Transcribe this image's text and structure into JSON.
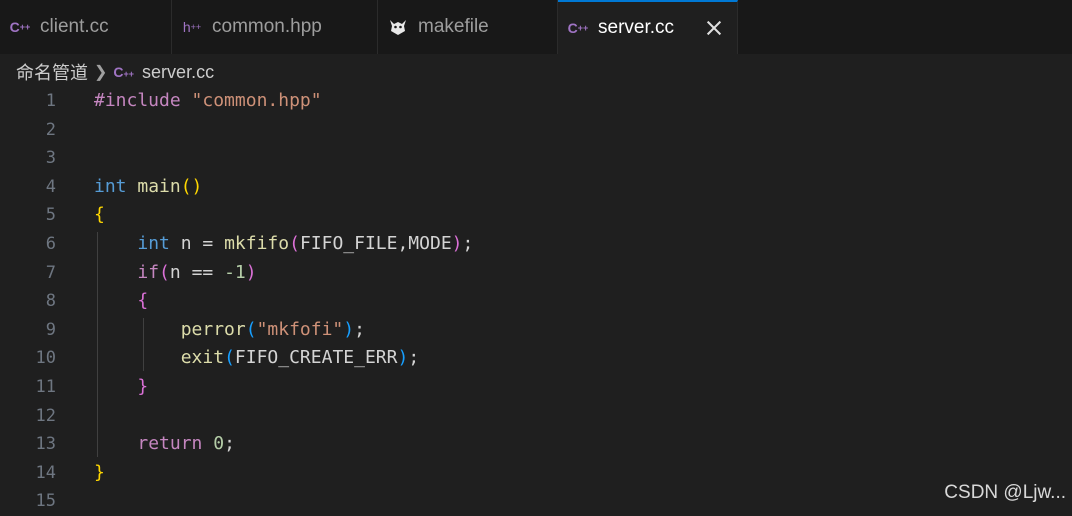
{
  "tabs": [
    {
      "label": "client.cc",
      "icon": "C++",
      "active": false
    },
    {
      "label": "common.hpp",
      "icon": "h++",
      "active": false
    },
    {
      "label": "makefile",
      "icon": "gnu-icon",
      "active": false
    },
    {
      "label": "server.cc",
      "icon": "C++",
      "active": true
    }
  ],
  "breadcrumb": {
    "folder": "命名管道",
    "file": "server.cc"
  },
  "editor": {
    "line_numbers": [
      "1",
      "2",
      "3",
      "4",
      "5",
      "6",
      "7",
      "8",
      "9",
      "10",
      "11",
      "12",
      "13",
      "14",
      "15"
    ],
    "lines": [
      [
        {
          "t": "#include ",
          "c": "#c586c0"
        },
        {
          "t": "\"common.hpp\"",
          "c": "#ce9178"
        }
      ],
      [],
      [],
      [
        {
          "t": "int",
          "c": "#569cd6"
        },
        {
          "t": " ",
          "c": "#d4d4d4"
        },
        {
          "t": "main",
          "c": "#dcdcaa"
        },
        {
          "t": "()",
          "c": "#ffd700"
        }
      ],
      [
        {
          "t": "{",
          "c": "#ffd700"
        }
      ],
      [
        {
          "t": "    ",
          "c": "#d4d4d4"
        },
        {
          "t": "int",
          "c": "#569cd6"
        },
        {
          "t": " n = ",
          "c": "#d4d4d4"
        },
        {
          "t": "mkfifo",
          "c": "#dcdcaa"
        },
        {
          "t": "(",
          "c": "#da70d6"
        },
        {
          "t": "FIFO_FILE,MODE",
          "c": "#d4d4d4"
        },
        {
          "t": ")",
          "c": "#da70d6"
        },
        {
          "t": ";",
          "c": "#d4d4d4"
        }
      ],
      [
        {
          "t": "    ",
          "c": "#d4d4d4"
        },
        {
          "t": "if",
          "c": "#c586c0"
        },
        {
          "t": "(",
          "c": "#da70d6"
        },
        {
          "t": "n == ",
          "c": "#d4d4d4"
        },
        {
          "t": "-1",
          "c": "#b5cea8"
        },
        {
          "t": ")",
          "c": "#da70d6"
        }
      ],
      [
        {
          "t": "    ",
          "c": "#d4d4d4"
        },
        {
          "t": "{",
          "c": "#da70d6"
        }
      ],
      [
        {
          "t": "        ",
          "c": "#d4d4d4"
        },
        {
          "t": "perror",
          "c": "#dcdcaa"
        },
        {
          "t": "(",
          "c": "#179fff"
        },
        {
          "t": "\"mkfofi\"",
          "c": "#ce9178"
        },
        {
          "t": ")",
          "c": "#179fff"
        },
        {
          "t": ";",
          "c": "#d4d4d4"
        }
      ],
      [
        {
          "t": "        ",
          "c": "#d4d4d4"
        },
        {
          "t": "exit",
          "c": "#dcdcaa"
        },
        {
          "t": "(",
          "c": "#179fff"
        },
        {
          "t": "FIFO_CREATE_ERR",
          "c": "#d4d4d4"
        },
        {
          "t": ")",
          "c": "#179fff"
        },
        {
          "t": ";",
          "c": "#d4d4d4"
        }
      ],
      [
        {
          "t": "    ",
          "c": "#d4d4d4"
        },
        {
          "t": "}",
          "c": "#da70d6"
        }
      ],
      [],
      [
        {
          "t": "    ",
          "c": "#d4d4d4"
        },
        {
          "t": "return",
          "c": "#c586c0"
        },
        {
          "t": " ",
          "c": "#d4d4d4"
        },
        {
          "t": "0",
          "c": "#b5cea8"
        },
        {
          "t": ";",
          "c": "#d4d4d4"
        }
      ],
      [
        {
          "t": "}",
          "c": "#ffd700"
        }
      ],
      []
    ]
  },
  "watermark": "CSDN @Ljw..."
}
